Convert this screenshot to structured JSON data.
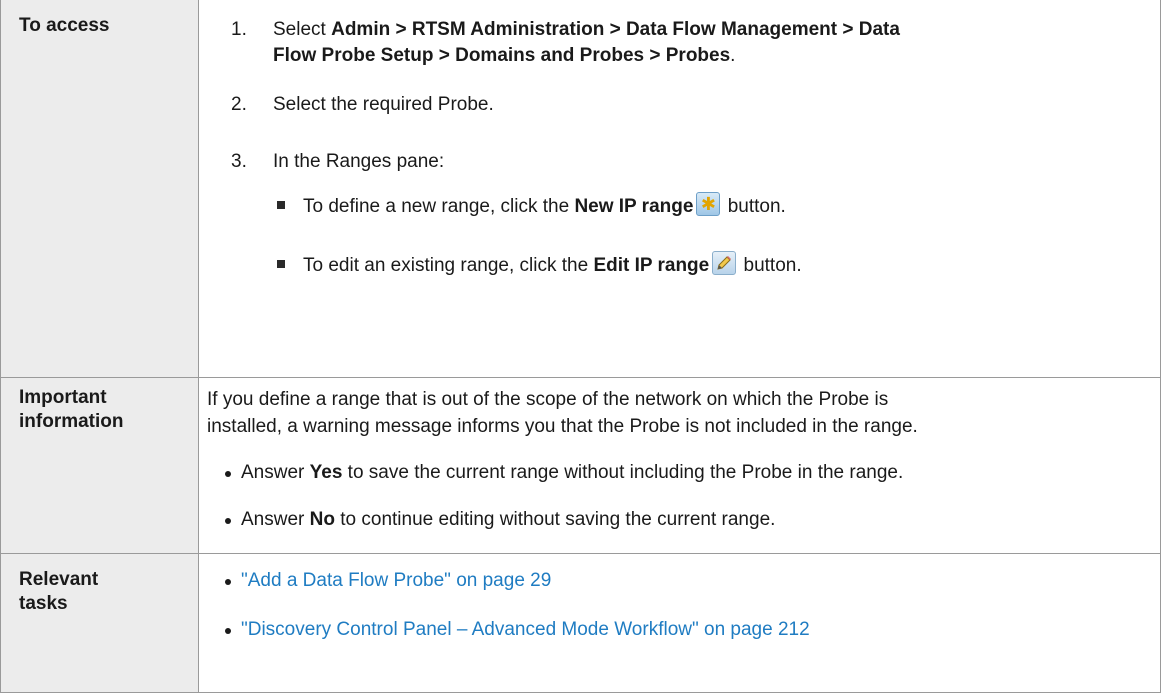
{
  "access": {
    "label": "To access",
    "step1": {
      "num": "1.",
      "pre": "Select ",
      "path_line1": "Admin > RTSM Administration > Data Flow Management > Data",
      "path_line2": "Flow Probe Setup > Domains and Probes > Probes",
      "post": "."
    },
    "step2": {
      "num": "2.",
      "text": "Select the required Probe."
    },
    "step3": {
      "num": "3.",
      "text": "In the Ranges pane:",
      "new_pre": "To define a new range, click the ",
      "new_bold": "New IP range",
      "new_post": " button.",
      "edit_pre": "To edit an existing range, click the ",
      "edit_bold": "Edit IP range",
      "edit_post": " button."
    },
    "icons": [
      "new-ip-range-icon",
      "edit-ip-range-icon"
    ]
  },
  "important": {
    "label_line1": "Important",
    "label_line2": "information",
    "para_line1": "If you define a range that is out of the scope of the network on which the Probe is",
    "para_line2": "installed, a warning message informs you that the Probe is not included in the range.",
    "yes_pre": "Answer ",
    "yes_bold": "Yes",
    "yes_post": " to save the current range without including the Probe in the range.",
    "no_pre": "Answer ",
    "no_bold": "No",
    "no_post": " to continue editing without saving the current range."
  },
  "relevant": {
    "label_line1": "Relevant",
    "label_line2": "tasks",
    "links": [
      "\"Add a Data Flow Probe\" on page 29",
      "\"Discovery Control Panel – Advanced Mode Workflow\" on page 212"
    ]
  },
  "colors": {
    "link": "#1f7cc2",
    "label_bg": "#ececec",
    "border": "#9a9a9a"
  }
}
